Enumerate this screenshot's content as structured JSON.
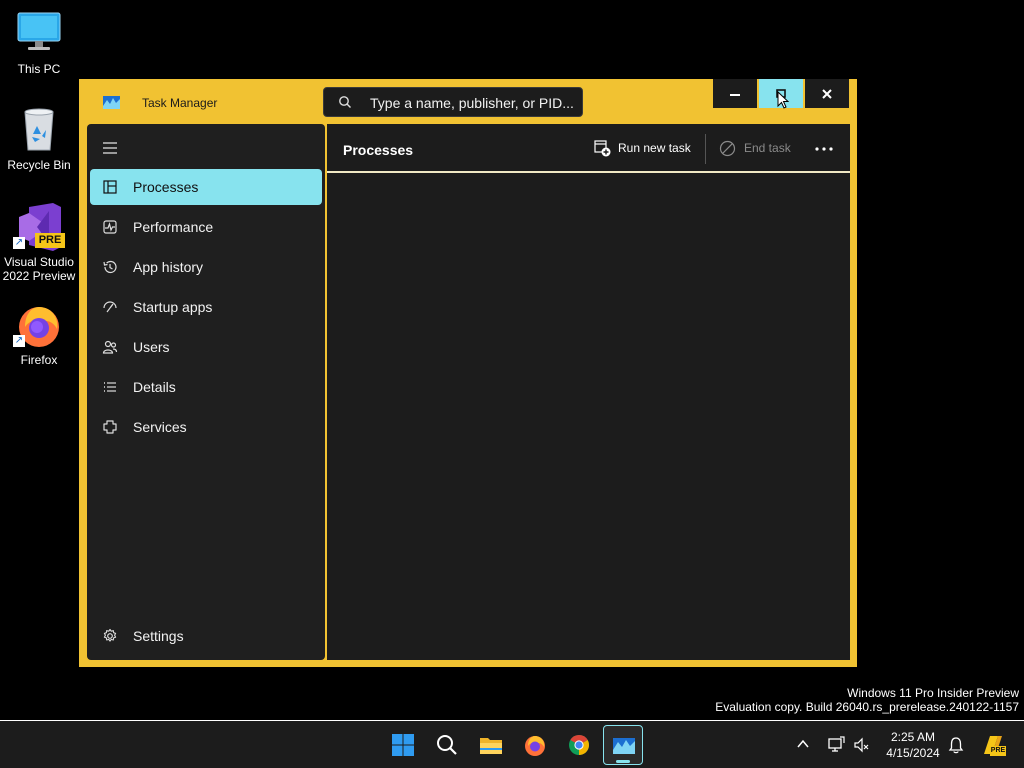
{
  "desktop": {
    "icons": [
      {
        "label": "This PC"
      },
      {
        "label": "Recycle Bin"
      },
      {
        "label": "Visual Studio 2022 Preview",
        "badge": "PRE"
      },
      {
        "label": "Firefox"
      }
    ],
    "watermark": {
      "line1": "Windows 11 Pro Insider Preview",
      "line2": "Evaluation copy. Build 26040.rs_prerelease.240122-1157"
    }
  },
  "window": {
    "title": "Task Manager",
    "search_placeholder": "Type a name, publisher, or PID...",
    "accent_color": "#f1c232",
    "selection_color": "#87e3ee"
  },
  "nav": {
    "items": [
      {
        "label": "Processes",
        "icon": "processes-icon",
        "active": true
      },
      {
        "label": "Performance",
        "icon": "performance-icon"
      },
      {
        "label": "App history",
        "icon": "app-history-icon"
      },
      {
        "label": "Startup apps",
        "icon": "startup-apps-icon"
      },
      {
        "label": "Users",
        "icon": "users-icon"
      },
      {
        "label": "Details",
        "icon": "details-icon"
      },
      {
        "label": "Services",
        "icon": "services-icon"
      }
    ],
    "settings": {
      "label": "Settings",
      "icon": "gear-icon"
    }
  },
  "main": {
    "page_title": "Processes",
    "run_new_task": "Run new task",
    "end_task": "End task"
  },
  "taskbar": {
    "pinned": [
      "start-icon",
      "search-icon",
      "file-explorer-icon",
      "firefox-icon",
      "chrome-icon",
      "task-manager-icon"
    ],
    "clock": {
      "time": "2:25 AM",
      "date": "4/15/2024"
    },
    "copilot_badge": "PRE"
  }
}
